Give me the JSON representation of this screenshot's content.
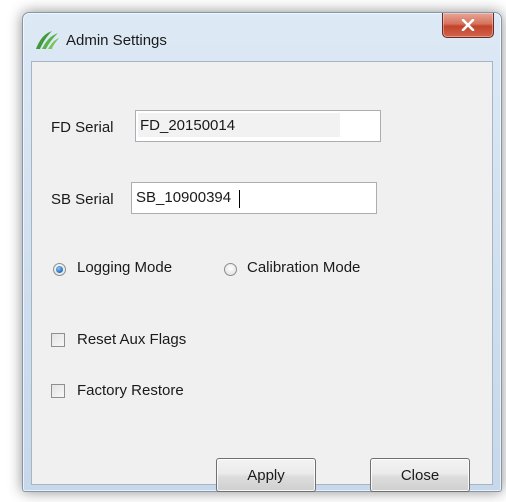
{
  "window": {
    "title": "Admin Settings",
    "app_icon": "leaf-logo-icon",
    "close_icon": "close-icon",
    "accent_close_color": "#c2432b"
  },
  "form": {
    "fd_serial": {
      "label": "FD Serial",
      "value": "FD_20150014"
    },
    "sb_serial": {
      "label": "SB Serial",
      "value": "SB_10900394"
    },
    "mode": {
      "options": [
        "Logging Mode",
        "Calibration Mode"
      ],
      "selected": "Logging Mode"
    },
    "reset_aux_flags": {
      "label": "Reset Aux Flags",
      "checked": false
    },
    "factory_restore": {
      "label": "Factory Restore",
      "checked": false
    }
  },
  "buttons": {
    "apply_label": "Apply",
    "close_label": "Close"
  }
}
